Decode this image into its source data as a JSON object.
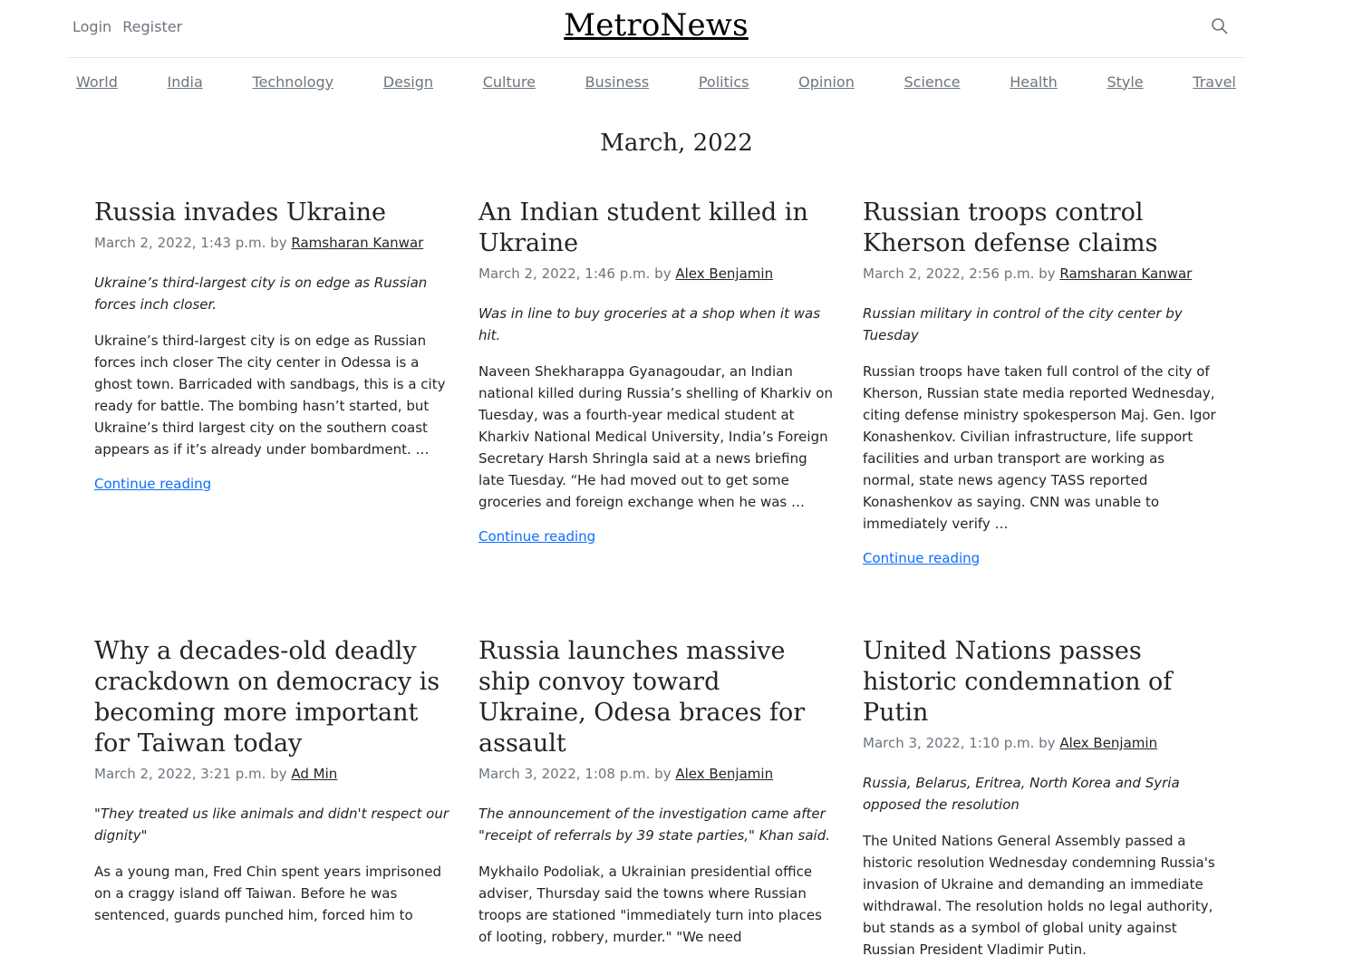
{
  "header": {
    "login": "Login",
    "register": "Register",
    "brand": "MetroNews"
  },
  "nav": [
    "World",
    "India",
    "Technology",
    "Design",
    "Culture",
    "Business",
    "Politics",
    "Opinion",
    "Science",
    "Health",
    "Style",
    "Travel"
  ],
  "archive_title": "March, 2022",
  "continue_label": "Continue reading",
  "posts": [
    {
      "title": "Russia invades Ukraine",
      "date": "March 2, 2022, 1:43 p.m. by",
      "author": "Ramsharan Kanwar",
      "lead": "Ukraine’s third-largest city is on edge as Russian forces inch closer.",
      "excerpt": "Ukraine’s third-largest city is on edge as Russian forces inch closer The city center in Odessa is a ghost town. Barricaded with sandbags, this is a city ready for battle. The bombing hasn’t started, but Ukraine’s third largest city on the southern coast appears as if it’s already under bombardment. …"
    },
    {
      "title": "An Indian student killed in Ukraine",
      "date": "March 2, 2022, 1:46 p.m. by",
      "author": "Alex Benjamin",
      "lead": "Was in line to buy groceries at a shop when it was hit.",
      "excerpt": "Naveen Shekharappa Gyanagoudar, an Indian national killed during Russia’s shelling of Kharkiv on Tuesday, was a fourth-year medical student at Kharkiv National Medical University, India’s Foreign Secretary Harsh Shringla said at a news briefing late Tuesday. “He had moved out to get some groceries and foreign exchange when he was …"
    },
    {
      "title": "Russian troops control Kherson defense claims",
      "date": "March 2, 2022, 2:56 p.m. by",
      "author": "Ramsharan Kanwar",
      "lead": "Russian military in control of the city center by Tuesday",
      "excerpt": "Russian troops have taken full control of the city of Kherson, Russian state media reported Wednesday, citing defense ministry spokesperson Maj. Gen. Igor Konashenkov. Civilian infrastructure, life support facilities and urban transport are working as normal, state news agency TASS reported Konashenkov as saying. CNN was unable to immediately verify …"
    },
    {
      "title": "Why a decades-old deadly crackdown on democracy is becoming more important for Taiwan today",
      "date": "March 2, 2022, 3:21 p.m. by",
      "author": "Ad Min",
      "lead": "\"They treated us like animals and didn't respect our dignity\"",
      "excerpt": "As a young man, Fred Chin spent years imprisoned on a craggy island off Taiwan. Before he was sentenced, guards punched him, forced him to"
    },
    {
      "title": "Russia launches massive ship convoy toward Ukraine, Odesa braces for assault",
      "date": "March 3, 2022, 1:08 p.m. by",
      "author": "Alex Benjamin",
      "lead": "The announcement of the investigation came after \"receipt of referrals by 39 state parties,\" Khan said.",
      "excerpt": "Mykhailo Podoliak, a Ukrainian presidential office adviser, Thursday said the towns where Russian troops are stationed \"immediately turn into places of looting, robbery, murder.\" \"We need"
    },
    {
      "title": "United Nations passes historic condemnation of Putin",
      "date": "March 3, 2022, 1:10 p.m. by",
      "author": "Alex Benjamin",
      "lead": "Russia, Belarus, Eritrea, North Korea and Syria opposed the resolution",
      "excerpt": "The United Nations General Assembly passed a historic resolution Wednesday condemning Russia's invasion of Ukraine and demanding an immediate withdrawal. The resolution holds no legal authority, but stands as a symbol of global unity against Russian President Vladimir Putin."
    }
  ]
}
